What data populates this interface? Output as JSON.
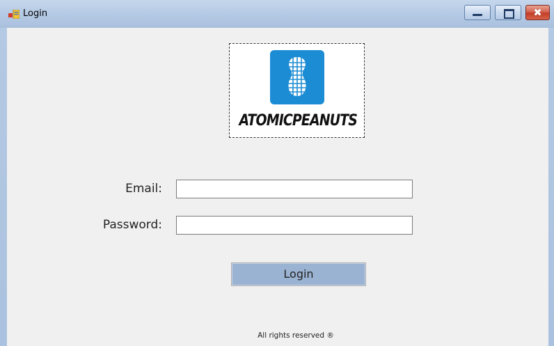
{
  "window": {
    "title": "Login",
    "app_icon": "winforms-app-icon",
    "controls": {
      "minimize": "minimize-icon",
      "maximize": "maximize-icon",
      "close_glyph": "✖"
    }
  },
  "logo": {
    "wordmark": "ATOMICPEANUTS",
    "icon": "peanut-grid-icon",
    "color": "#1c8cd4"
  },
  "form": {
    "email_label": "Email:",
    "email_value": "",
    "password_label": "Password:",
    "password_value": "",
    "login_button": "Login"
  },
  "footer": {
    "text": "All rights reserved ®"
  }
}
